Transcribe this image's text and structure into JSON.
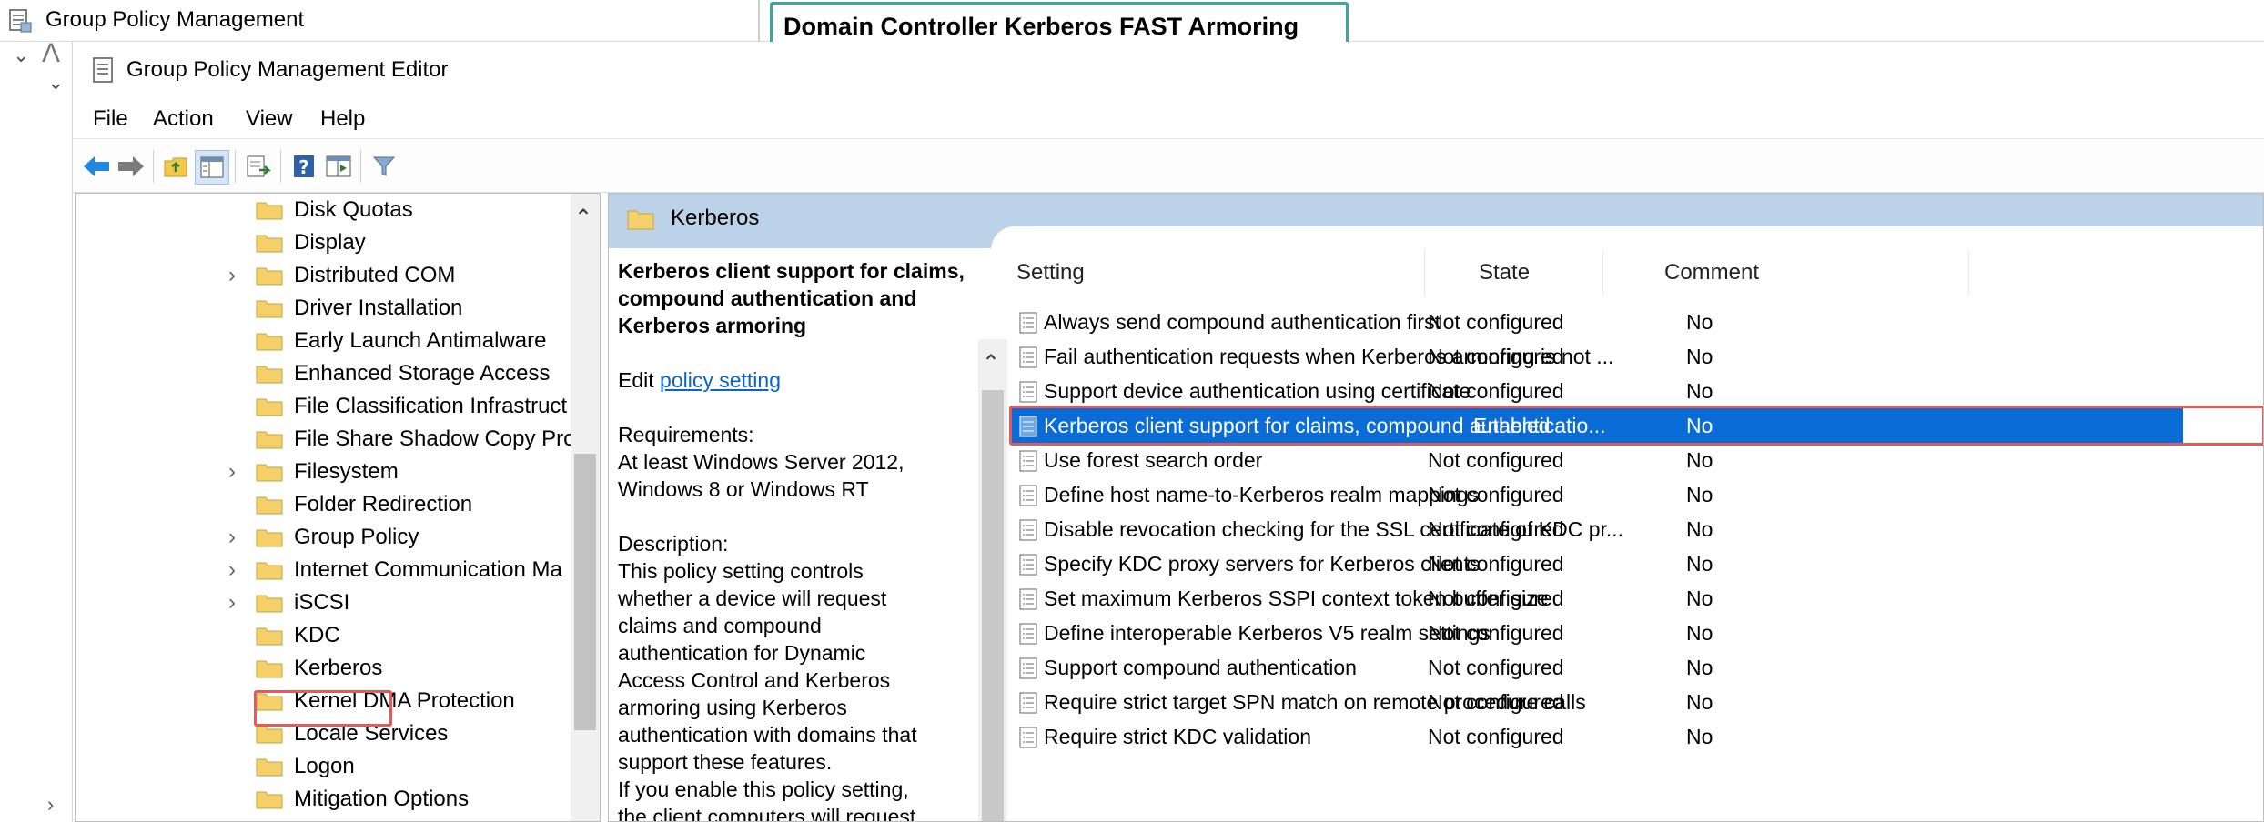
{
  "background_window": {
    "title": "Group Policy Management",
    "callout": "Domain Controller Kerberos FAST Armoring"
  },
  "editor": {
    "title": "Group Policy Management Editor",
    "menu": [
      "File",
      "Action",
      "View",
      "Help"
    ],
    "toolbar_icons": [
      "back-arrow-icon",
      "forward-arrow-icon",
      "up-folder-icon",
      "show-hide-tree-icon",
      "export-list-icon",
      "help-icon",
      "properties-icon",
      "filter-icon"
    ]
  },
  "tree": {
    "items": [
      {
        "label": "Disk Quotas",
        "expandable": false
      },
      {
        "label": "Display",
        "expandable": false
      },
      {
        "label": "Distributed COM",
        "expandable": true
      },
      {
        "label": "Driver Installation",
        "expandable": false
      },
      {
        "label": "Early Launch Antimalware",
        "expandable": false
      },
      {
        "label": "Enhanced Storage Access",
        "expandable": false
      },
      {
        "label": "File Classification Infrastruct",
        "expandable": false
      },
      {
        "label": "File Share Shadow Copy Prov",
        "expandable": false
      },
      {
        "label": "Filesystem",
        "expandable": true
      },
      {
        "label": "Folder Redirection",
        "expandable": false
      },
      {
        "label": "Group Policy",
        "expandable": true
      },
      {
        "label": "Internet Communication Ma",
        "expandable": true
      },
      {
        "label": "iSCSI",
        "expandable": true
      },
      {
        "label": "KDC",
        "expandable": false
      },
      {
        "label": "Kerberos",
        "expandable": false,
        "selected": true
      },
      {
        "label": "Kernel DMA Protection",
        "expandable": false
      },
      {
        "label": "Locale Services",
        "expandable": false
      },
      {
        "label": "Logon",
        "expandable": false
      },
      {
        "label": "Mitigation Options",
        "expandable": false
      }
    ]
  },
  "right": {
    "header_title": "Kerberos",
    "description": {
      "title_lines": [
        "Kerberos client support for claims,",
        "compound authentication and",
        "Kerberos armoring"
      ],
      "edit_prefix": "Edit",
      "edit_link": "policy setting",
      "requirements_label": "Requirements:",
      "requirements_lines": [
        "At least Windows Server 2012,",
        "Windows 8 or Windows RT"
      ],
      "description_label": "Description:",
      "description_lines": [
        "This policy setting controls",
        "whether a device will request",
        "claims and compound",
        "authentication for Dynamic",
        "Access Control and Kerberos",
        "armoring using Kerberos",
        "authentication with domains that",
        "support these features.",
        "If you enable this policy setting,",
        "the client computers will request"
      ]
    },
    "columns": {
      "setting": "Setting",
      "state": "State",
      "comment": "Comment"
    },
    "rows": [
      {
        "setting": "Always send compound authentication first",
        "state": "Not configured",
        "comment": "No"
      },
      {
        "setting": "Fail authentication requests when Kerberos armoring is not ...",
        "state": "Not configured",
        "comment": "No"
      },
      {
        "setting": "Support device authentication using certificate",
        "state": "Not configured",
        "comment": "No"
      },
      {
        "setting": "Kerberos client support for claims, compound authenticatio...",
        "state": "Enabled",
        "comment": "No",
        "selected": true
      },
      {
        "setting": "Use forest search order",
        "state": "Not configured",
        "comment": "No"
      },
      {
        "setting": "Define host name-to-Kerberos realm mappings",
        "state": "Not configured",
        "comment": "No"
      },
      {
        "setting": "Disable revocation checking for the SSL certificate of KDC pr...",
        "state": "Not configured",
        "comment": "No"
      },
      {
        "setting": "Specify KDC proxy servers for Kerberos clients",
        "state": "Not configured",
        "comment": "No"
      },
      {
        "setting": "Set maximum Kerberos SSPI context token buffer size",
        "state": "Not configured",
        "comment": "No"
      },
      {
        "setting": "Define interoperable Kerberos V5 realm settings",
        "state": "Not configured",
        "comment": "No"
      },
      {
        "setting": "Support compound authentication",
        "state": "Not configured",
        "comment": "No"
      },
      {
        "setting": "Require strict target SPN match on remote procedure calls",
        "state": "Not configured",
        "comment": "No"
      },
      {
        "setting": "Require strict KDC validation",
        "state": "Not configured",
        "comment": "No"
      }
    ]
  },
  "colors": {
    "selection": "#0a6cd6",
    "highlight_box": "#e15b5b",
    "callout_border": "#3aa7a0",
    "header_bg": "#bcd2e8",
    "folder": "#f4d06a"
  }
}
